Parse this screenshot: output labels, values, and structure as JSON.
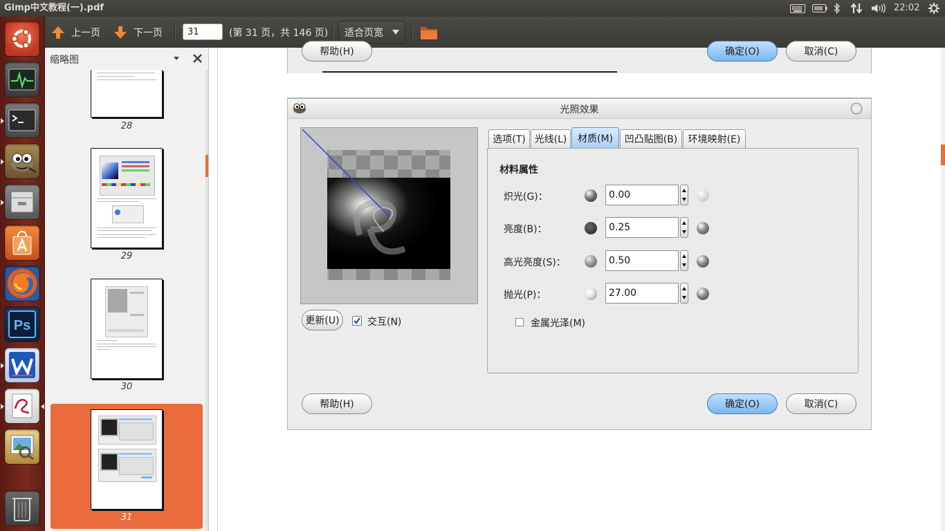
{
  "panel": {
    "window_title": "Gimp中文教程(一).pdf",
    "clock": "22:02"
  },
  "toolbar": {
    "prev_label": "上一页",
    "next_label": "下一页",
    "page_value": "31",
    "page_info": "(第 31 页，共 146 页)",
    "zoom_label": "适合页宽"
  },
  "sidebar": {
    "title": "缩略图",
    "thumbnails": [
      "28",
      "29",
      "30",
      "31"
    ],
    "selected": "31"
  },
  "document": {
    "top_buttons": {
      "help": "帮助(H)",
      "ok": "确定(O)",
      "cancel": "取消(C)"
    },
    "dialog": {
      "title": "光照效果",
      "update_button": "更新(U)",
      "interactive_label": "交互(N)",
      "interactive_checked": true,
      "tabs": [
        "选项(T)",
        "光线(L)",
        "材质(M)",
        "凹凸贴图(B)",
        "环境映射(E)"
      ],
      "active_tab": "材质(M)",
      "section_title": "材料属性",
      "properties": [
        {
          "label": "炽光(G)：",
          "value": "0.00"
        },
        {
          "label": "亮度(B)：",
          "value": "0.25"
        },
        {
          "label": "高光亮度(S)：",
          "value": "0.50"
        },
        {
          "label": "抛光(P)：",
          "value": "27.00"
        }
      ],
      "metallic_label": "金属光泽(M)",
      "metallic_checked": false,
      "help_button": "帮助(H)",
      "ok_button": "确定(O)",
      "cancel_button": "取消(C)"
    }
  },
  "colors": {
    "launcher_bg": "#7a2a1e",
    "selection_orange": "#e96b3b",
    "panel_bg": "#3c3b37"
  }
}
